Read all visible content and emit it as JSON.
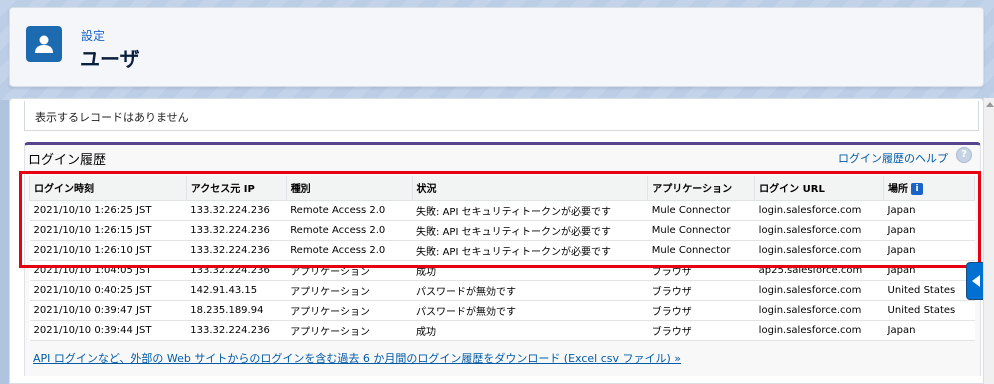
{
  "header": {
    "breadcrumb": "設定",
    "title": "ユーザ",
    "icon": "user-icon"
  },
  "no_records_text": "表示するレコードはありません",
  "login_history": {
    "title": "ログイン履歴",
    "help_link": "ログイン履歴のヘルプ",
    "help_icon": "?",
    "columns": [
      "ログイン時刻",
      "アクセス元 IP",
      "種別",
      "状況",
      "アプリケーション",
      "ログイン URL",
      "場所"
    ],
    "location_info_icon": "i",
    "rows": [
      [
        "2021/10/10 1:26:25 JST",
        "133.32.224.236",
        "Remote Access 2.0",
        "失敗: API セキュリティトークンが必要です",
        "Mule Connector",
        "login.salesforce.com",
        "Japan"
      ],
      [
        "2021/10/10 1:26:15 JST",
        "133.32.224.236",
        "Remote Access 2.0",
        "失敗: API セキュリティトークンが必要です",
        "Mule Connector",
        "login.salesforce.com",
        "Japan"
      ],
      [
        "2021/10/10 1:26:10 JST",
        "133.32.224.236",
        "Remote Access 2.0",
        "失敗: API セキュリティトークンが必要です",
        "Mule Connector",
        "login.salesforce.com",
        "Japan"
      ],
      [
        "2021/10/10 1:04:05 JST",
        "133.32.224.236",
        "アプリケーション",
        "成功",
        "ブラウザ",
        "ap25.salesforce.com",
        "Japan"
      ],
      [
        "2021/10/10 0:40:25 JST",
        "142.91.43.15",
        "アプリケーション",
        "パスワードが無効です",
        "ブラウザ",
        "login.salesforce.com",
        "United States"
      ],
      [
        "2021/10/10 0:39:47 JST",
        "18.235.189.94",
        "アプリケーション",
        "パスワードが無効です",
        "ブラウザ",
        "login.salesforce.com",
        "United States"
      ],
      [
        "2021/10/10 0:39:44 JST",
        "133.32.224.236",
        "アプリケーション",
        "成功",
        "ブラウザ",
        "login.salesforce.com",
        "Japan"
      ]
    ],
    "download_link": "API ログインなど、外部の Web サイトからのログインを含む過去 6 か月間のログイン履歴をダウンロード (Excel csv ファイル) »"
  },
  "colors": {
    "highlight_border": "#e60012",
    "section_accent": "#56458c",
    "link": "#015ba7",
    "icon_bg": "#1c6bb0"
  }
}
